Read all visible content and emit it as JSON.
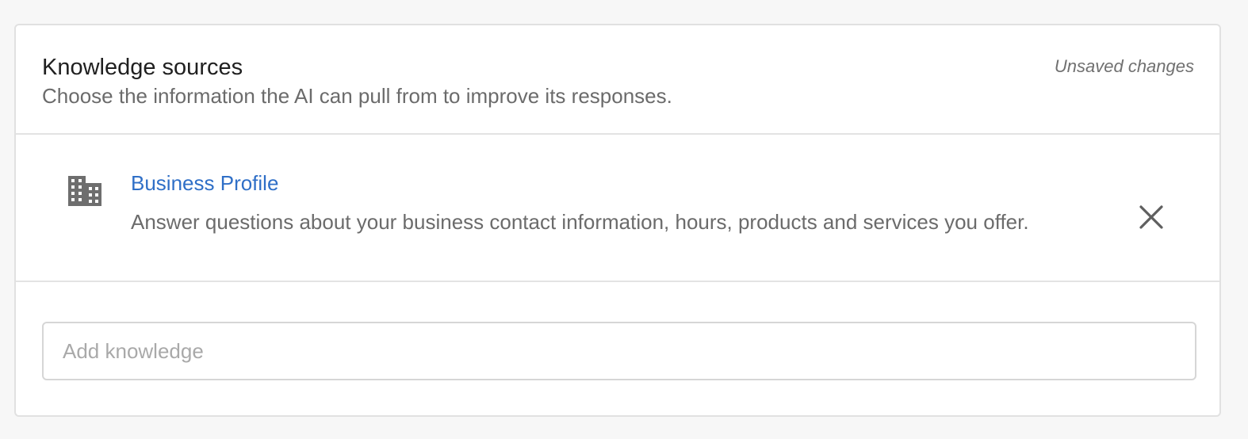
{
  "header": {
    "title": "Knowledge sources",
    "subtitle": "Choose the information the AI can pull from to improve its responses.",
    "status": "Unsaved changes"
  },
  "sources": [
    {
      "icon": "building-icon",
      "name": "Business Profile",
      "description": "Answer questions about your business contact information, hours, products and services you offer."
    }
  ],
  "add_knowledge": {
    "placeholder": "Add knowledge",
    "value": ""
  },
  "colors": {
    "link": "#2f6fc7",
    "text_primary": "#202020",
    "text_secondary": "#6b6b6b",
    "border": "#e1e1e1"
  }
}
